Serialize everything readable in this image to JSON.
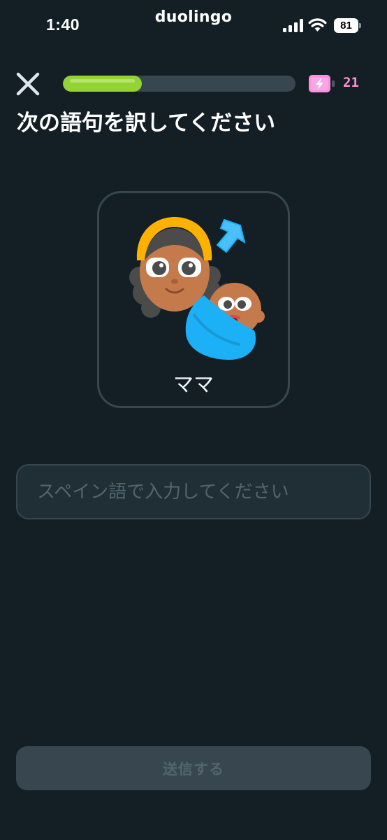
{
  "status_bar": {
    "time": "1:40",
    "app_brand": "duolingo",
    "battery_level": "81"
  },
  "lesson": {
    "progress": 0.34,
    "energy_count": "21",
    "instruction": "次の語句を訳してください"
  },
  "card": {
    "word": "ママ",
    "illustration": "mother-and-baby-with-audio-arrow"
  },
  "answer": {
    "value": "",
    "placeholder": "スペイン語で入力してください"
  },
  "submit": {
    "label": "送信する"
  },
  "colors": {
    "background": "#131f24",
    "progress_fill": "#93d333",
    "progress_track": "#37464f",
    "energy": "#ff90d9",
    "border": "#37464f",
    "disabled_text": "#52656d"
  },
  "icons": {
    "close": "close-icon",
    "energy": "energy-bolt-icon",
    "signal": "signal-icon",
    "wifi": "wifi-icon",
    "battery": "battery-icon"
  }
}
